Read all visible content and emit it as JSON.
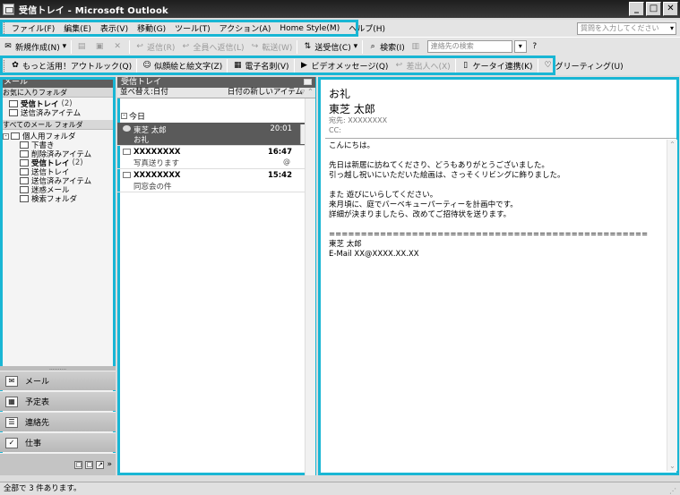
{
  "window": {
    "title": "受信トレイ - Microsoft Outlook",
    "buttons": [
      "_",
      "□",
      "✕"
    ]
  },
  "menu": {
    "items": [
      "ファイル(F)",
      "編集(E)",
      "表示(V)",
      "移動(G)",
      "ツール(T)",
      "アクション(A)",
      "Home Style(M)",
      "ヘルプ(H)"
    ],
    "help_placeholder": "質問を入力してください"
  },
  "toolbar1": {
    "new_label": "新規作成(N)",
    "reply_label": "返信(R)",
    "reply_all_label": "全員へ返信(L)",
    "forward_label": "転送(W)",
    "send_receive_label": "送受信(C)",
    "search_label": "検索(I)",
    "contact_search_placeholder": "連絡先の検索"
  },
  "toolbar2": {
    "items": [
      "もっと活用！アウトルック(Q)",
      "似顔絵と絵文字(Z)",
      "電子名刺(V)",
      "ビデオメッセージ(Q)",
      "差出人へ(X)",
      "ケータイ連携(K)",
      "グリーティング(U)"
    ]
  },
  "nav": {
    "header": "メール",
    "favorites_header": "お気に入りフォルダ",
    "favorites": [
      {
        "label": "受信トレイ",
        "count": "(2)",
        "bold": true
      },
      {
        "label": "送信済みアイテム",
        "count": "",
        "bold": false
      }
    ],
    "all_header": "すべてのメール フォルダ",
    "root_folder": "個人用フォルダ",
    "folders": [
      {
        "label": "下書き",
        "count": "",
        "bold": false
      },
      {
        "label": "削除済みアイテム",
        "count": "",
        "bold": false
      },
      {
        "label": "受信トレイ",
        "count": "(2)",
        "bold": true
      },
      {
        "label": "送信トレイ",
        "count": "",
        "bold": false
      },
      {
        "label": "送信済みアイテム",
        "count": "",
        "bold": false
      },
      {
        "label": "迷惑メール",
        "count": "",
        "bold": false
      },
      {
        "label": "検索フォルダ",
        "count": "",
        "bold": false
      }
    ],
    "buttons": [
      "メール",
      "予定表",
      "連絡先",
      "仕事"
    ],
    "splitter": "..........",
    "bottom_icons": [
      "□",
      "□",
      "↗",
      "»"
    ]
  },
  "list": {
    "header": "受信トレイ",
    "sort_label": "並べ替え:日付",
    "sort_order": "日付の新しいアイテム",
    "group": "今日",
    "messages": [
      {
        "from": "東芝 太郎",
        "subject": "お礼",
        "time": "20:01",
        "selected": true,
        "attachment": ""
      },
      {
        "from": "XXXXXXXX",
        "subject": "写真送ります",
        "time": "16:47",
        "selected": false,
        "attachment": "@"
      },
      {
        "from": "XXXXXXXX",
        "subject": "同窓会の件",
        "time": "15:42",
        "selected": false,
        "attachment": ""
      }
    ]
  },
  "reading": {
    "subject": "お礼",
    "from": "東芝 太郎",
    "to": "宛先:  XXXXXXXX",
    "cc": "CC:",
    "body": [
      "こんにちは。",
      "",
      "先日は新居に訪ねてくださり、どうもありがとうございました。",
      "引っ越し祝いにいただいた絵画は、さっそくリビングに飾りました。",
      "",
      "また 遊びにいらしてください。",
      "来月頃に、庭でバーベキューパーティーを計画中です。",
      "詳細が決まりましたら、改めてご招待状を送ります。",
      "",
      "==================================================",
      "東芝 太郎",
      "E-Mail XX@XXXX.XX.XX"
    ]
  },
  "status": {
    "text": "全部で 3 件あります。"
  }
}
